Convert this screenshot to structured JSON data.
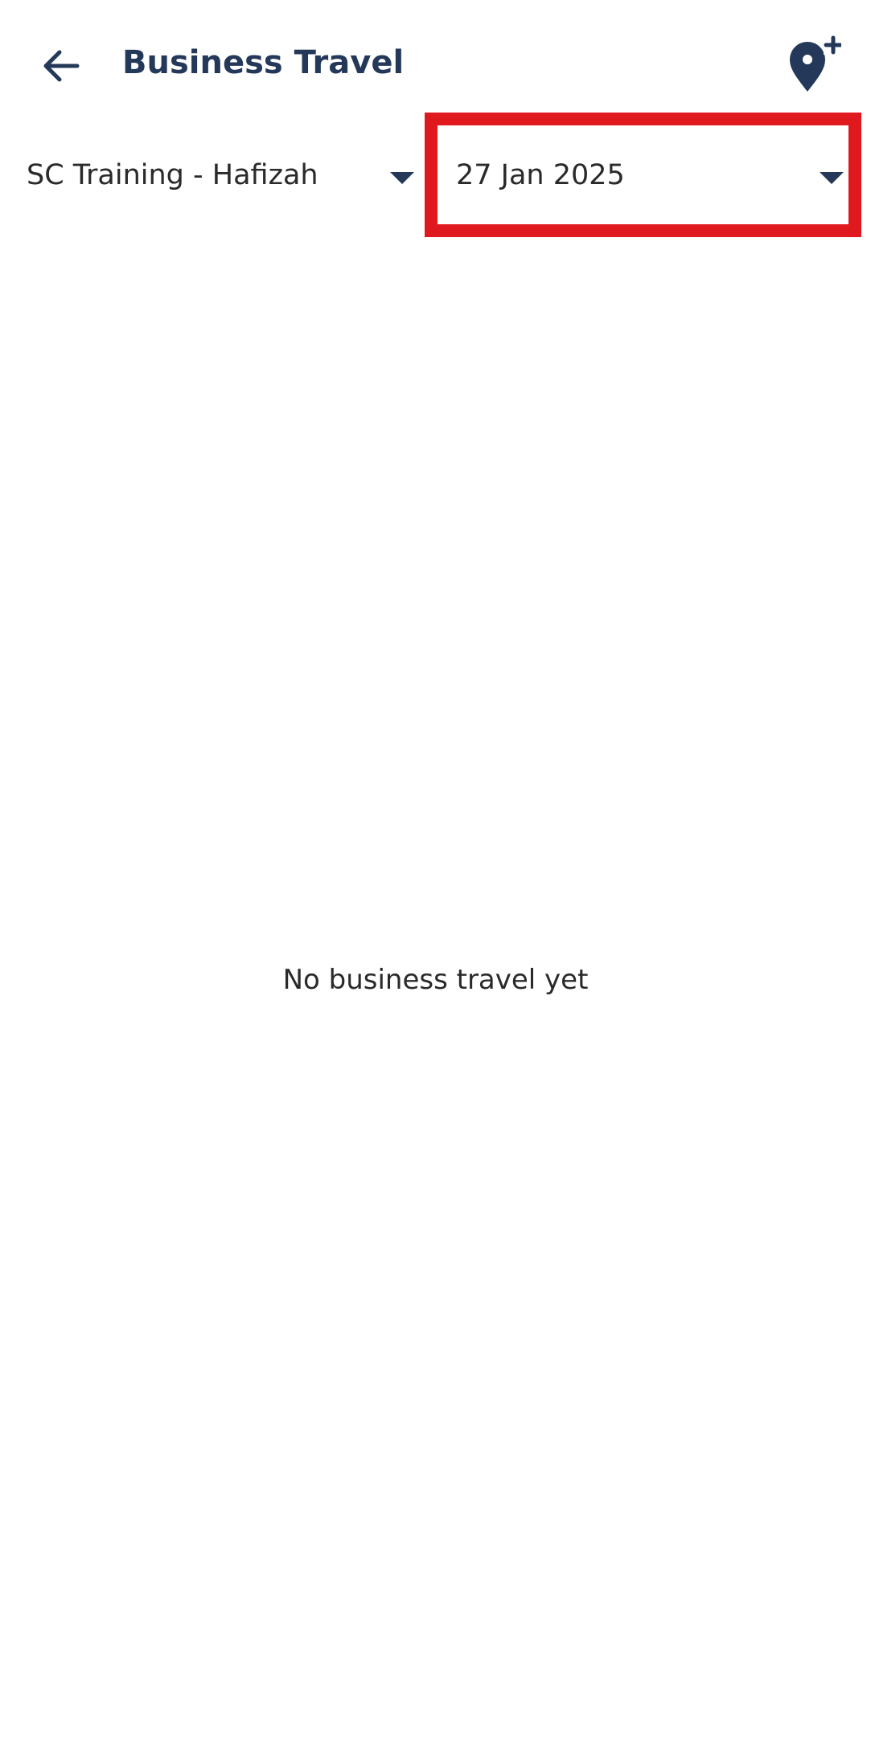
{
  "header": {
    "title": "Business Travel",
    "back_icon": "arrow-left-icon",
    "action_icon": "location-pin-add-icon"
  },
  "filters": {
    "account": {
      "value": "SC Training - Hafizah",
      "icon": "caret-down-icon"
    },
    "date": {
      "value": "27 Jan 2025",
      "icon": "caret-down-icon"
    }
  },
  "content": {
    "empty_message": "No business travel yet"
  },
  "colors": {
    "primary": "#24395a",
    "highlight": "#e0191e",
    "background": "#ffffff",
    "text": "#2a2a2a"
  }
}
